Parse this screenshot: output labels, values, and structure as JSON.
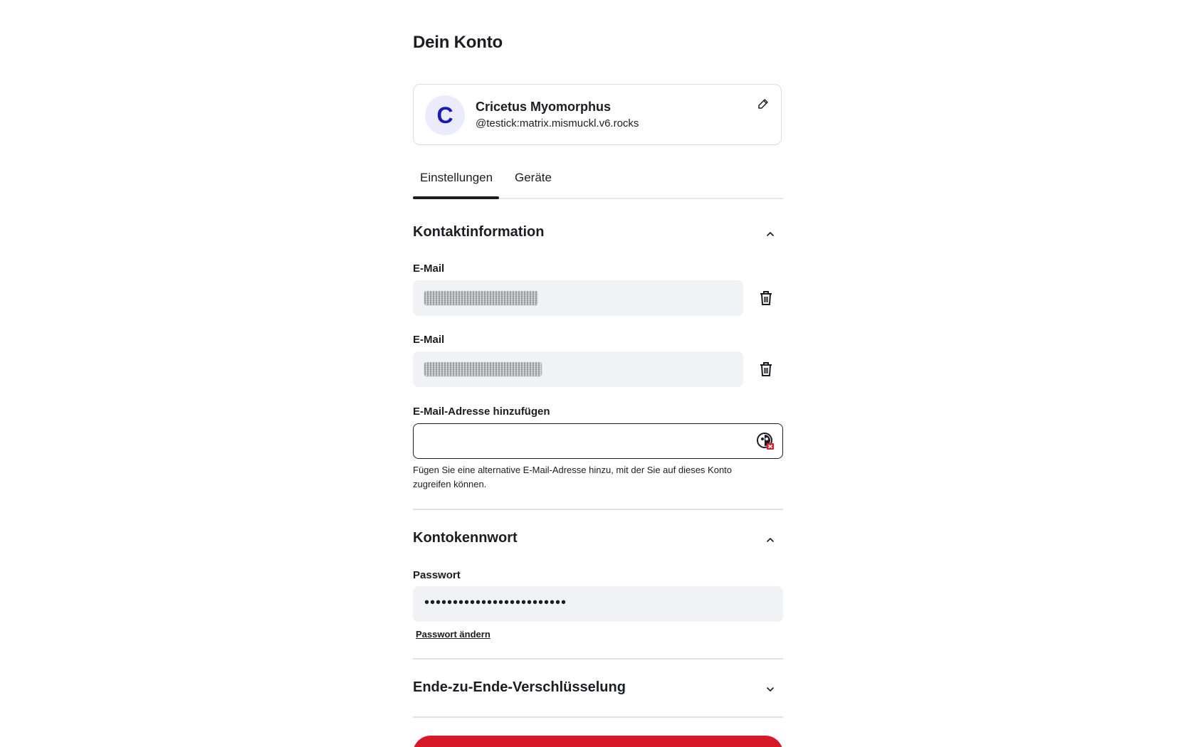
{
  "page": {
    "title": "Dein Konto"
  },
  "profile": {
    "avatar_letter": "C",
    "display_name": "Cricetus Myomorphus",
    "user_id": "@testick:matrix.mismuckl.v6.rocks"
  },
  "tabs": [
    {
      "label": "Einstellungen",
      "active": true
    },
    {
      "label": "Geräte",
      "active": false
    }
  ],
  "contact": {
    "title": "Kontaktinformation",
    "emails": [
      {
        "label": "E-Mail"
      },
      {
        "label": "E-Mail"
      }
    ],
    "add_label": "E-Mail-Adresse hinzufügen",
    "add_value": "",
    "help_text": "Fügen Sie eine alternative E-Mail-Adresse hinzu, mit der Sie auf dieses Konto zugreifen können."
  },
  "password_section": {
    "title": "Kontokennwort",
    "label": "Passwort",
    "masked_value": "•••••••••••••••••••••••••",
    "change_link": "Passwort ändern"
  },
  "encryption_section": {
    "title": "Ende-zu-Ende-Verschlüsselung"
  },
  "colors": {
    "accent_avatar_bg": "#ecebfb",
    "accent_avatar_fg": "#1a19b8",
    "danger": "#d51928",
    "field_bg": "#f0f2f5"
  }
}
